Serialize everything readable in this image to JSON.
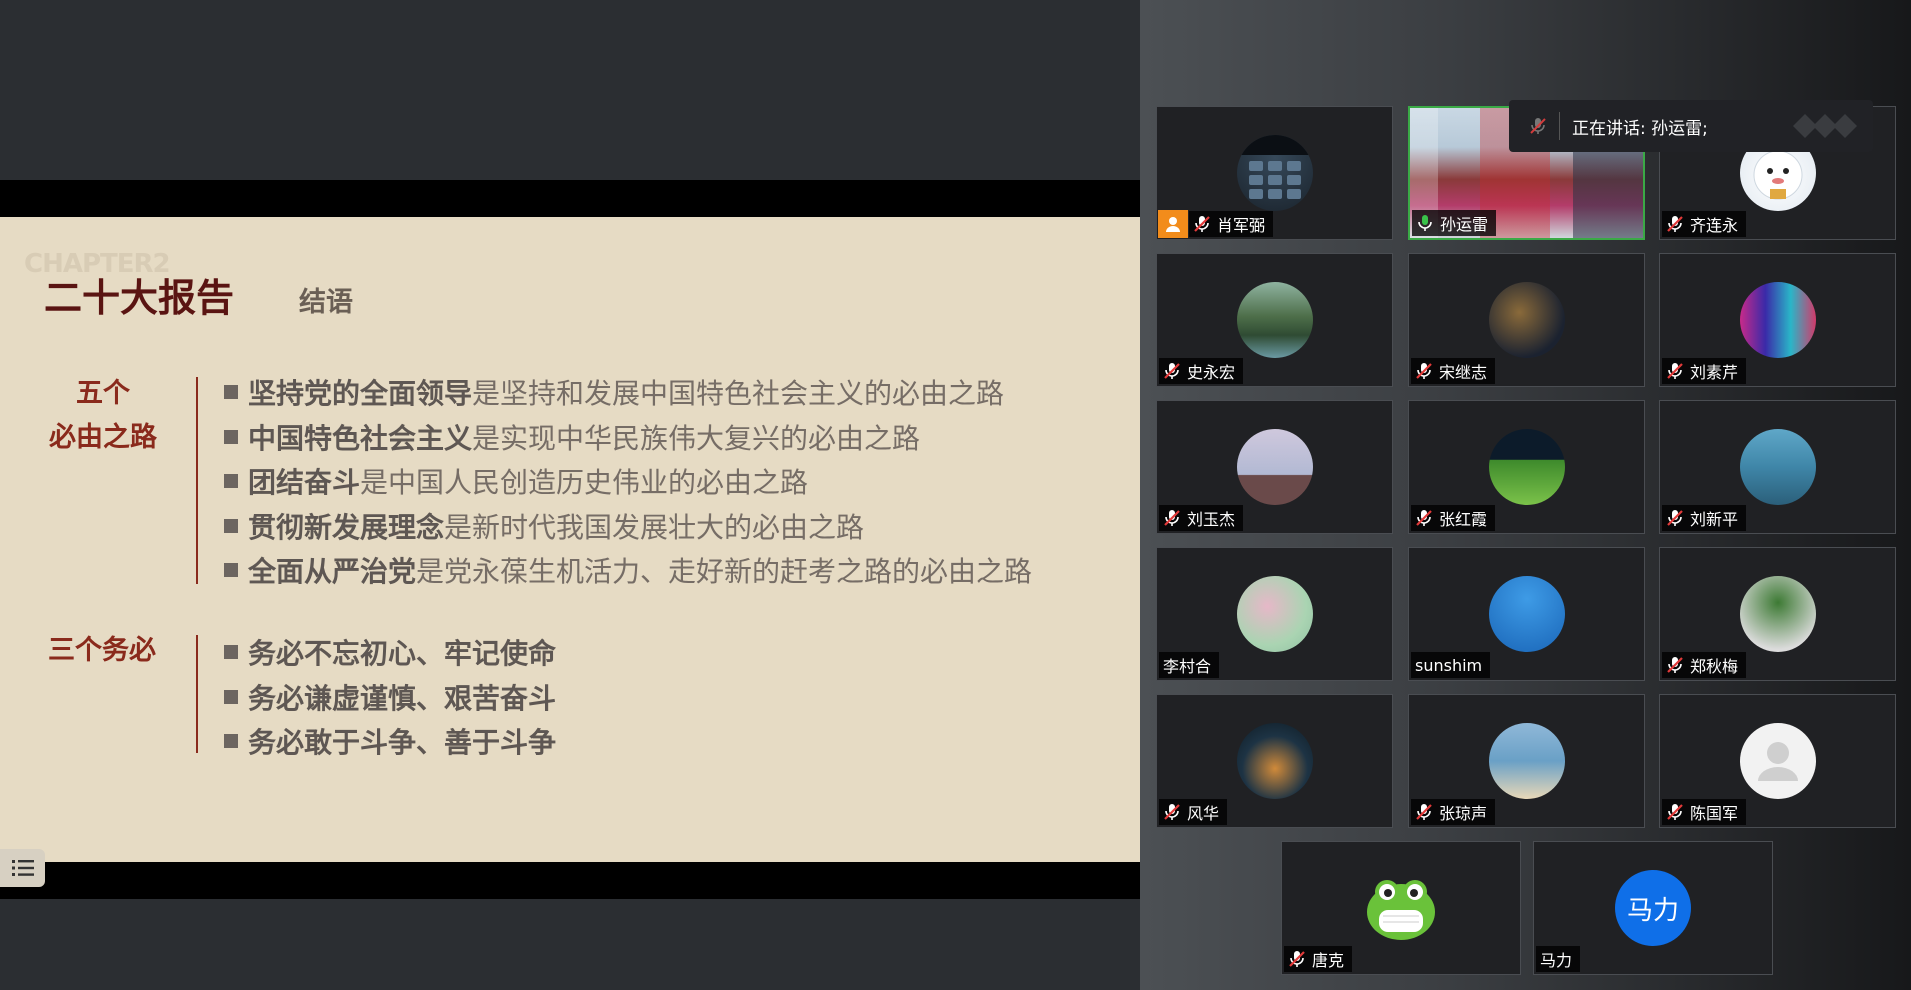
{
  "slide": {
    "watermark": "CHAPTER2",
    "title": "二十大报告",
    "subtitle": "结语",
    "section1": {
      "label_line1": "五个",
      "label_line2": "必由之路",
      "items": [
        {
          "bold": "坚持党的全面领导",
          "rest": "是坚持和发展中国特色社会主义的必由之路"
        },
        {
          "bold": "中国特色社会主义",
          "rest": "是实现中华民族伟大复兴的必由之路"
        },
        {
          "bold": "团结奋斗",
          "rest": "是中国人民创造历史伟业的必由之路"
        },
        {
          "bold": "贯彻新发展理念",
          "rest": "是新时代我国发展壮大的必由之路"
        },
        {
          "bold": "全面从严治党",
          "rest": "是党永葆生机活力、走好新的赶考之路的必由之路"
        }
      ]
    },
    "section2": {
      "label": "三个务必",
      "items": [
        {
          "bold": "务必不忘初心、牢记使命"
        },
        {
          "bold": "务必谦虚谨慎、艰苦奋斗"
        },
        {
          "bold": "务必敢于斗争、善于斗争"
        }
      ]
    }
  },
  "toolbar": {
    "slide_menu_icon": "list-icon"
  },
  "speaking": {
    "text": "正在讲话: 孙运雷;"
  },
  "participants": [
    {
      "name": "肖军弼",
      "muted": true,
      "host": true,
      "avatar": "phone-keypad"
    },
    {
      "name": "孙运雷",
      "muted": false,
      "active": true,
      "avatar": "video-feed"
    },
    {
      "name": "齐连永",
      "muted": true,
      "avatar": "cartoon-mascot"
    },
    {
      "name": "史永宏",
      "muted": true,
      "avatar": "lake-scenery"
    },
    {
      "name": "宋继志",
      "muted": true,
      "avatar": "city-night"
    },
    {
      "name": "刘素芹",
      "muted": true,
      "avatar": "neon-lights"
    },
    {
      "name": "刘玉杰",
      "muted": true,
      "avatar": "sky-bird"
    },
    {
      "name": "张红霞",
      "muted": true,
      "avatar": "stadium-field"
    },
    {
      "name": "刘新平",
      "muted": true,
      "avatar": "sea-coast"
    },
    {
      "name": "李村合",
      "muted": false,
      "avatar": "flowers"
    },
    {
      "name": "sunshim",
      "muted": false,
      "avatar": "blue-sky"
    },
    {
      "name": "郑秋梅",
      "muted": true,
      "avatar": "potted-plant"
    },
    {
      "name": "风华",
      "muted": true,
      "avatar": "night-couple"
    },
    {
      "name": "张琼声",
      "muted": true,
      "avatar": "beach-person"
    },
    {
      "name": "陈国军",
      "muted": true,
      "avatar": "default-user"
    },
    {
      "name": "唐克",
      "muted": true,
      "avatar": "frog-mask"
    },
    {
      "name": "马力",
      "muted": false,
      "avatar": "initials",
      "initials": "马力"
    }
  ]
}
